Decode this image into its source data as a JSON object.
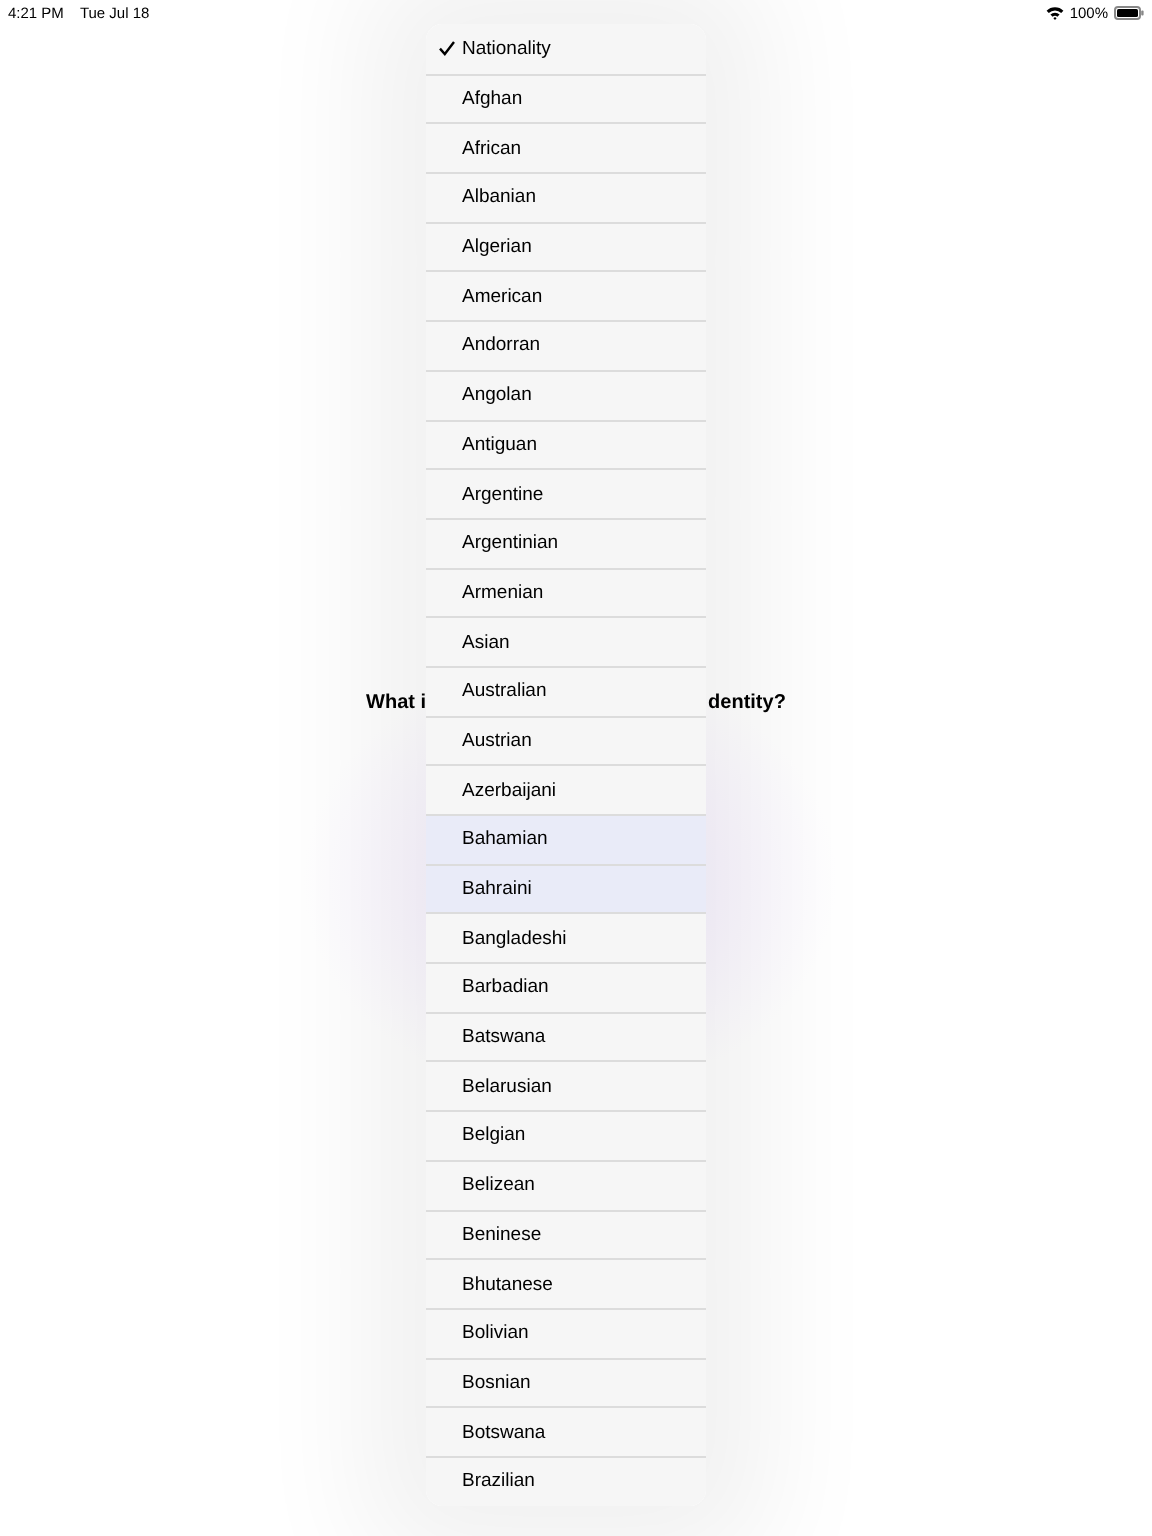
{
  "status_bar": {
    "time": "4:21 PM",
    "date": "Tue Jul 18",
    "battery": "100%"
  },
  "question": {
    "visible_start": "What i",
    "visible_end": "dentity?"
  },
  "menu": {
    "items": [
      {
        "label": "Nationality",
        "selected": true
      },
      {
        "label": "Afghan",
        "selected": false
      },
      {
        "label": "African",
        "selected": false
      },
      {
        "label": "Albanian",
        "selected": false
      },
      {
        "label": "Algerian",
        "selected": false
      },
      {
        "label": "American",
        "selected": false
      },
      {
        "label": "Andorran",
        "selected": false
      },
      {
        "label": "Angolan",
        "selected": false
      },
      {
        "label": "Antiguan",
        "selected": false
      },
      {
        "label": "Argentine",
        "selected": false
      },
      {
        "label": "Argentinian",
        "selected": false
      },
      {
        "label": "Armenian",
        "selected": false
      },
      {
        "label": "Asian",
        "selected": false
      },
      {
        "label": "Australian",
        "selected": false
      },
      {
        "label": "Austrian",
        "selected": false
      },
      {
        "label": "Azerbaijani",
        "selected": false
      },
      {
        "label": "Bahamian",
        "selected": false
      },
      {
        "label": "Bahraini",
        "selected": false
      },
      {
        "label": "Bangladeshi",
        "selected": false
      },
      {
        "label": "Barbadian",
        "selected": false
      },
      {
        "label": "Batswana",
        "selected": false
      },
      {
        "label": "Belarusian",
        "selected": false
      },
      {
        "label": "Belgian",
        "selected": false
      },
      {
        "label": "Belizean",
        "selected": false
      },
      {
        "label": "Beninese",
        "selected": false
      },
      {
        "label": "Bhutanese",
        "selected": false
      },
      {
        "label": "Bolivian",
        "selected": false
      },
      {
        "label": "Bosnian",
        "selected": false
      },
      {
        "label": "Botswana",
        "selected": false
      },
      {
        "label": "Brazilian",
        "selected": false
      }
    ]
  }
}
